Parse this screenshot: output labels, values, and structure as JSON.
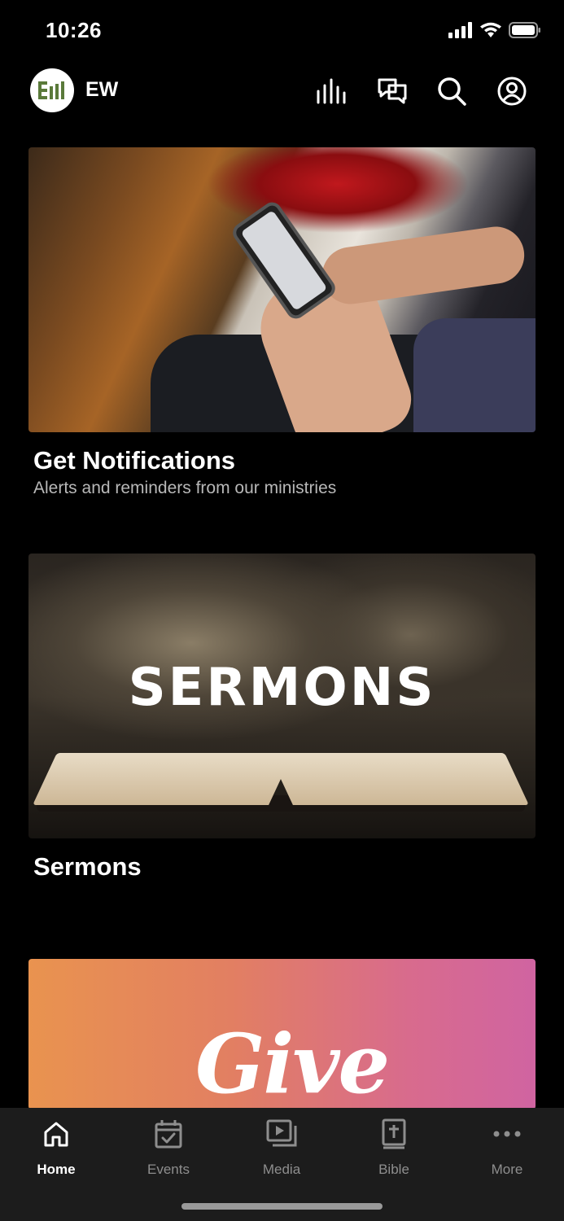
{
  "status": {
    "time": "10:26"
  },
  "header": {
    "org_name": "EW",
    "icons": [
      "levels-icon",
      "chat-icon",
      "search-icon",
      "profile-icon"
    ]
  },
  "cards": [
    {
      "title": "Get Notifications",
      "subtitle": "Alerts and reminders from our ministries"
    },
    {
      "title": "Sermons",
      "image_text": "SERMONS"
    },
    {
      "image_text": "Give"
    }
  ],
  "tabs": [
    {
      "label": "Home",
      "icon": "home-icon",
      "active": true
    },
    {
      "label": "Events",
      "icon": "calendar-icon",
      "active": false
    },
    {
      "label": "Media",
      "icon": "media-icon",
      "active": false
    },
    {
      "label": "Bible",
      "icon": "bible-icon",
      "active": false
    },
    {
      "label": "More",
      "icon": "more-icon",
      "active": false
    }
  ],
  "colors": {
    "background": "#000000",
    "tab_bar": "#1c1c1c",
    "logo_green": "#5a7a3a"
  }
}
